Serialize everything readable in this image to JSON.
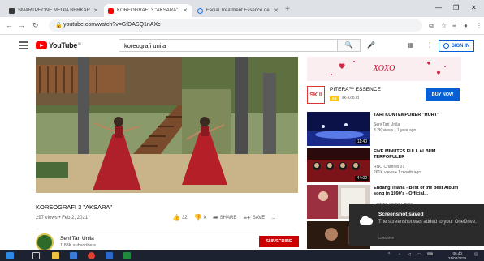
{
  "browser": {
    "tabs": [
      {
        "title": "SMARTPHONE MEDIA BERKARYA",
        "active": false
      },
      {
        "title": "KOREOGRAFI 3 \"AKSARA\"",
        "active": true
      },
      {
        "title": "Facial Treatment Essence dengu",
        "active": false
      }
    ],
    "new_tab": "+",
    "url": "youtube.com/watch?v=GfDASQ1nAXc"
  },
  "youtube": {
    "logo_text": "YouTube",
    "logo_region": "ID",
    "search_query": "koreografi unila",
    "sign_in_label": "SIGN IN"
  },
  "video": {
    "title": "KOREOGRAFI 3 \"AKSARA\"",
    "meta": "297 views • Feb 2, 2021",
    "likes": "32",
    "dislikes": "0",
    "share_label": "SHARE",
    "save_label": "SAVE",
    "more": "..."
  },
  "channel": {
    "name": "Seni Tari Unila",
    "subscribers": "1.88K subscribers",
    "subscribe_label": "SUBSCRIBE"
  },
  "ad": {
    "banner_text": "XOXO",
    "logo_text": "SK II",
    "name": "PITERA™ ESSENCE",
    "tag": "Ad",
    "domain": "sk-ii.co.id",
    "cta": "BUY NOW"
  },
  "recommendations": [
    {
      "title": "TARI KONTEMPORER \"HURT\"",
      "channel": "Seni Tari Unila",
      "stats": "3.2K views • 1 year ago",
      "duration": "11:40"
    },
    {
      "title": "FIVE MINUTES FULL ALBUM TERPOPULER",
      "channel": "RNO Channel 07",
      "stats": "261K views • 1 month ago",
      "duration": "44:02"
    },
    {
      "title": "Endang Triana - Best of the best Album song in 1990's - Official...",
      "channel": "Endang Triana Official",
      "stats": "",
      "duration": ""
    },
    {
      "title": "",
      "channel": "",
      "stats": "",
      "duration": ""
    }
  ],
  "toast": {
    "title": "Screenshot saved",
    "body": "The screenshot was added to your OneDrive.",
    "source": "OneDrive"
  },
  "taskbar": {
    "time": "06.40",
    "date": "21/02/2021"
  }
}
